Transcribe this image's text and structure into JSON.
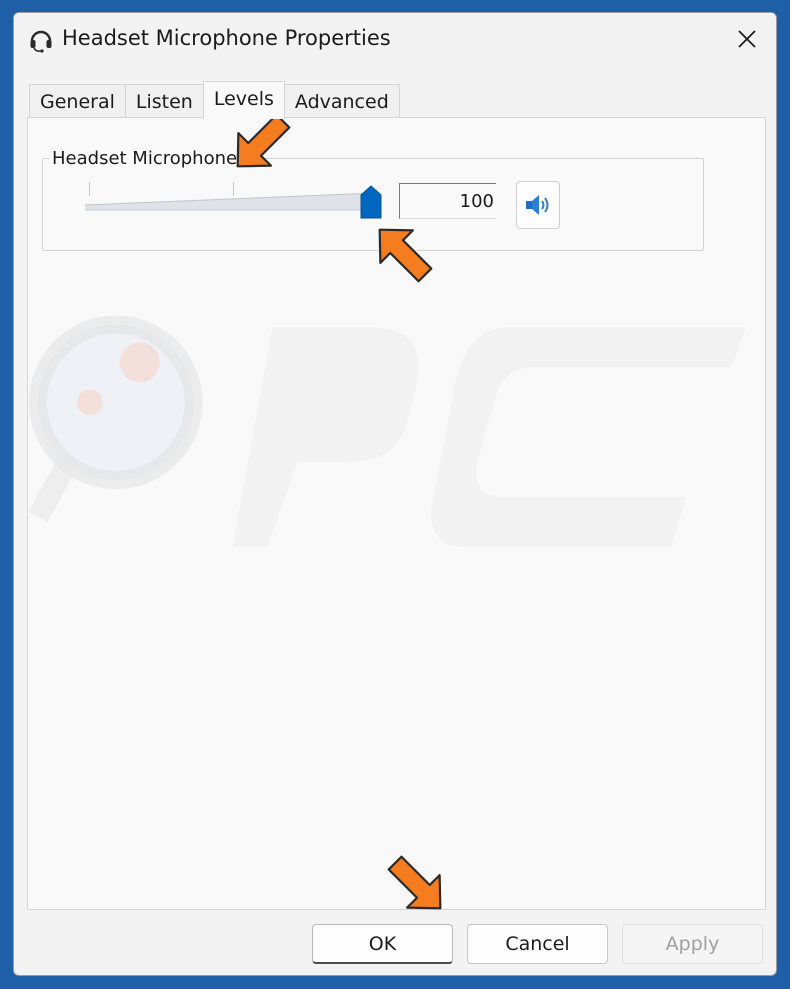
{
  "window": {
    "title": "Headset Microphone Properties",
    "icon": "headset-icon",
    "close_icon": "close-icon"
  },
  "tabs": [
    {
      "label": "General",
      "active": false
    },
    {
      "label": "Listen",
      "active": false
    },
    {
      "label": "Levels",
      "active": true
    },
    {
      "label": "Advanced",
      "active": false
    }
  ],
  "levels": {
    "group_label": "Headset Microphone",
    "level_value": "100",
    "slider_fraction": 1.0,
    "mute_icon": "speaker-icon"
  },
  "footer": {
    "ok_label": "OK",
    "cancel_label": "Cancel",
    "apply_label": "Apply"
  },
  "colors": {
    "accent": "#0067c0",
    "arrow": "#f57c1f",
    "background": "#1f5fa8"
  }
}
